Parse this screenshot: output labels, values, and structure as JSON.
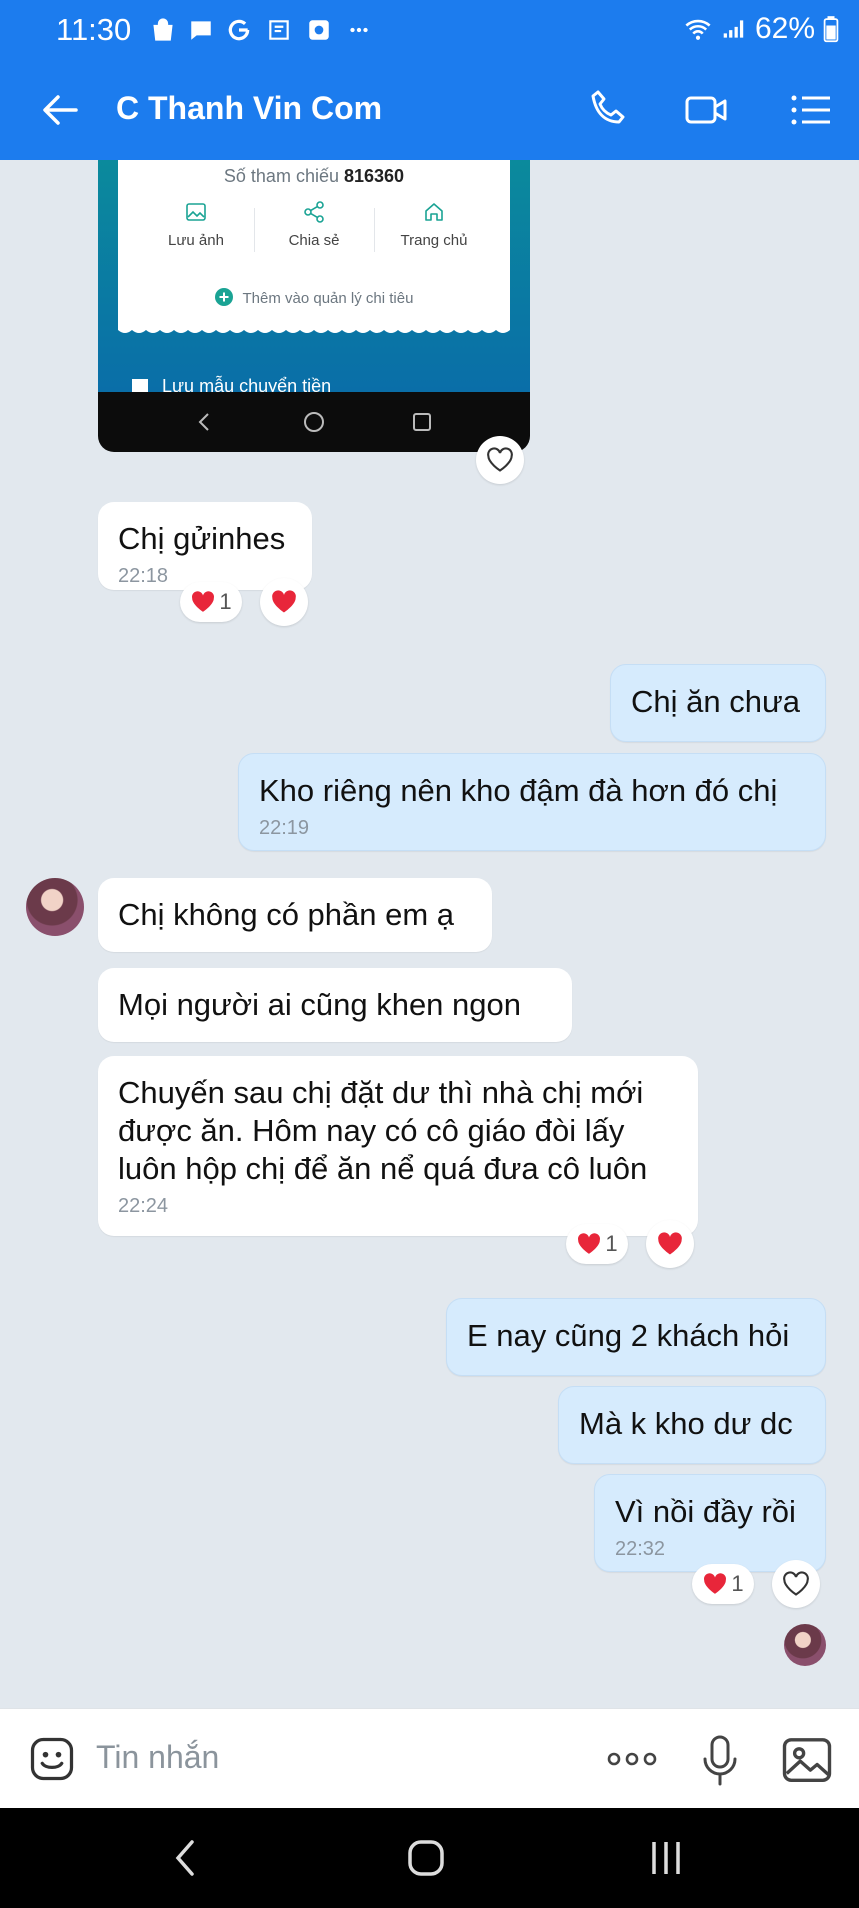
{
  "status_bar": {
    "time": "11:30",
    "battery": "62%"
  },
  "header": {
    "title": "C Thanh Vin Com"
  },
  "shared_image": {
    "reference_label": "Số tham chiếu",
    "reference_number": "816360",
    "actions": [
      "Lưu ảnh",
      "Chia sẻ",
      "Trang chủ"
    ],
    "add_to_spending": "Thêm vào quản lý chi tiêu",
    "save_template": "Lưu mẫu chuyển tiền"
  },
  "messages": [
    {
      "id": "m1",
      "direction": "in",
      "text": "Chị gửinhes",
      "time": "22:18",
      "reaction_count": "1"
    },
    {
      "id": "m2",
      "direction": "out",
      "text": "Chị ăn chưa"
    },
    {
      "id": "m3",
      "direction": "out",
      "text": "Kho riêng nên kho đậm đà hơn đó chị",
      "time": "22:19"
    },
    {
      "id": "m4",
      "direction": "in",
      "text": "Chị không có phần em ạ"
    },
    {
      "id": "m5",
      "direction": "in",
      "text": "Mọi người ai cũng khen ngon"
    },
    {
      "id": "m6",
      "direction": "in",
      "text": "Chuyến sau chị đặt dư thì nhà chị mới được ăn. Hôm nay có cô giáo  đòi lấy luôn hộp chị để ăn nể quá đưa cô luôn",
      "time": "22:24",
      "reaction_count": "1"
    },
    {
      "id": "m7",
      "direction": "out",
      "text": "E nay cũng 2 khách hỏi"
    },
    {
      "id": "m8",
      "direction": "out",
      "text": "Mà k kho dư dc"
    },
    {
      "id": "m9",
      "direction": "out",
      "text": "Vì nồi đầy rồi",
      "time": "22:32",
      "reaction_count": "1"
    }
  ],
  "input": {
    "placeholder": "Tin nhắn"
  },
  "colors": {
    "header": "#1c7cee",
    "chat_bg": "#e2e8ee",
    "outgoing": "#d6ebfd",
    "incoming": "#ffffff",
    "heart": "#e8263a"
  },
  "icons": [
    "back-arrow-icon",
    "phone-icon",
    "video-call-icon",
    "menu-list-icon",
    "sticker-icon",
    "more-icon",
    "microphone-icon",
    "image-icon"
  ]
}
